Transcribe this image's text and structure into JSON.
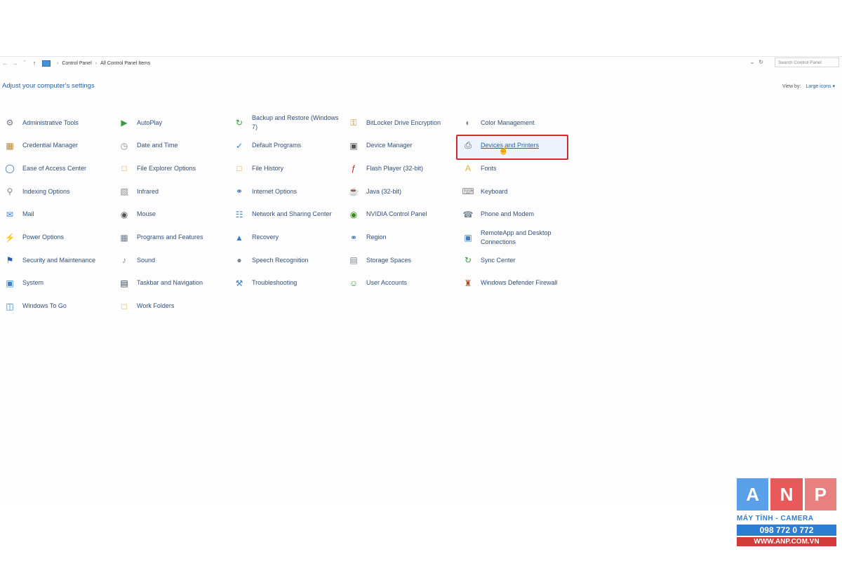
{
  "address": {
    "breadcrumb": [
      "Control Panel",
      "All Control Panel Items"
    ],
    "search_placeholder": "Search Control Panel"
  },
  "header": {
    "title": "Adjust your computer's settings"
  },
  "view_by": {
    "label": "View by:",
    "value": "Large icons"
  },
  "items": [
    {
      "label": "Administrative Tools",
      "icon": "admin-tools-icon",
      "color": "#6b7a8c"
    },
    {
      "label": "Credential Manager",
      "icon": "credential-icon",
      "color": "#b8862b"
    },
    {
      "label": "Ease of Access Center",
      "icon": "ease-access-icon",
      "color": "#2f6db8"
    },
    {
      "label": "Indexing Options",
      "icon": "indexing-icon",
      "color": "#7a8896"
    },
    {
      "label": "Mail",
      "icon": "mail-icon",
      "color": "#3a7fc8"
    },
    {
      "label": "Power Options",
      "icon": "power-icon",
      "color": "#3c9a3c"
    },
    {
      "label": "Security and Maintenance",
      "icon": "flag-icon",
      "color": "#2a5fb0"
    },
    {
      "label": "System",
      "icon": "system-icon",
      "color": "#3a7fc8"
    },
    {
      "label": "Windows To Go",
      "icon": "windows-to-go-icon",
      "color": "#3a7fc8"
    },
    {
      "label": "AutoPlay",
      "icon": "autoplay-icon",
      "color": "#3c9a3c"
    },
    {
      "label": "Date and Time",
      "icon": "clock-icon",
      "color": "#7a8896"
    },
    {
      "label": "File Explorer Options",
      "icon": "folder-icon",
      "color": "#e0b030"
    },
    {
      "label": "Infrared",
      "icon": "infrared-icon",
      "color": "#8a8a8a"
    },
    {
      "label": "Mouse",
      "icon": "mouse-icon",
      "color": "#555"
    },
    {
      "label": "Programs and Features",
      "icon": "programs-icon",
      "color": "#6b7a8c"
    },
    {
      "label": "Sound",
      "icon": "sound-icon",
      "color": "#8a8a8a"
    },
    {
      "label": "Taskbar and Navigation",
      "icon": "taskbar-icon",
      "color": "#2a3a55"
    },
    {
      "label": "Work Folders",
      "icon": "work-folders-icon",
      "color": "#e0b030"
    },
    {
      "label": "Backup and Restore (Windows 7)",
      "icon": "backup-icon",
      "color": "#3c9a3c"
    },
    {
      "label": "Default Programs",
      "icon": "default-programs-icon",
      "color": "#3a7fc8"
    },
    {
      "label": "File History",
      "icon": "file-history-icon",
      "color": "#e0b030"
    },
    {
      "label": "Internet Options",
      "icon": "globe-icon",
      "color": "#2f6db8"
    },
    {
      "label": "Network and Sharing Center",
      "icon": "network-icon",
      "color": "#3a7fc8"
    },
    {
      "label": "Recovery",
      "icon": "recovery-icon",
      "color": "#3a7fc8"
    },
    {
      "label": "Speech Recognition",
      "icon": "microphone-icon",
      "color": "#7a8896"
    },
    {
      "label": "Troubleshooting",
      "icon": "troubleshoot-icon",
      "color": "#3a7fc8"
    },
    {
      "label": "BitLocker Drive Encryption",
      "icon": "bitlocker-icon",
      "color": "#b8862b"
    },
    {
      "label": "Device Manager",
      "icon": "device-manager-icon",
      "color": "#555"
    },
    {
      "label": "Flash Player (32-bit)",
      "icon": "flash-icon",
      "color": "#b02020"
    },
    {
      "label": "Java (32-bit)",
      "icon": "java-icon",
      "color": "#d07020"
    },
    {
      "label": "NVIDIA Control Panel",
      "icon": "nvidia-icon",
      "color": "#3a8a1a"
    },
    {
      "label": "Region",
      "icon": "region-icon",
      "color": "#2f6db8"
    },
    {
      "label": "Storage Spaces",
      "icon": "storage-icon",
      "color": "#7a8896"
    },
    {
      "label": "User Accounts",
      "icon": "user-accounts-icon",
      "color": "#3c9a3c"
    },
    {
      "label": "Color Management",
      "icon": "color-management-icon",
      "color": "#7a8896"
    },
    {
      "label": "Devices and Printers",
      "icon": "printer-icon",
      "color": "#555"
    },
    {
      "label": "Fonts",
      "icon": "fonts-icon",
      "color": "#e0b030"
    },
    {
      "label": "Keyboard",
      "icon": "keyboard-icon",
      "color": "#8a8a8a"
    },
    {
      "label": "Phone and Modem",
      "icon": "phone-icon",
      "color": "#7a8896"
    },
    {
      "label": "RemoteApp and Desktop Connections",
      "icon": "remoteapp-icon",
      "color": "#3a7fc8"
    },
    {
      "label": "Sync Center",
      "icon": "sync-icon",
      "color": "#3c9a3c"
    },
    {
      "label": "Windows Defender Firewall",
      "icon": "firewall-icon",
      "color": "#b05020"
    }
  ],
  "highlighted": "Devices and Printers",
  "watermark": {
    "letters": [
      "A",
      "N",
      "P"
    ],
    "line1": "MÁY TÍNH - CAMERA",
    "line2": "098 772 0 772",
    "line3": "WWW.ANP.COM.VN"
  }
}
